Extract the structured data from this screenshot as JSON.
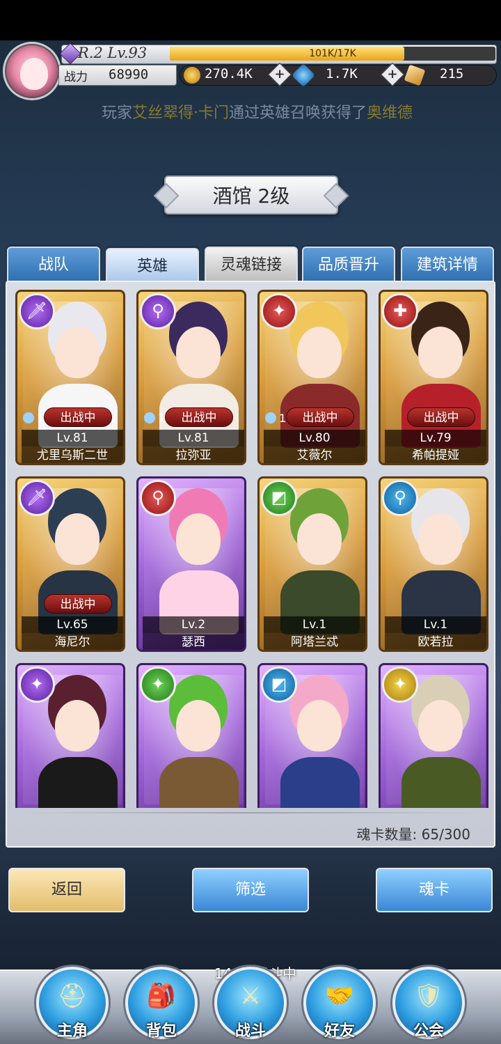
{
  "header": {
    "level_text": "R.2 Lv.93",
    "exp_text": "101K/17K",
    "exp_fraction": 0.72,
    "power_label": "战力",
    "power_value": "68990",
    "gold": "270.4K",
    "diamond": "1.7K",
    "ticket": "215",
    "ticker_prefix": "玩家",
    "ticker_player": "艾丝翠得·卡门",
    "ticker_mid": "通过英雄召唤获得了",
    "ticker_hero": "奥维德"
  },
  "title": "酒馆 2级",
  "tabs": [
    {
      "label": "战队",
      "style": "blue"
    },
    {
      "label": "英雄",
      "style": "active"
    },
    {
      "label": "灵魂链接",
      "style": "alt"
    },
    {
      "label": "品质晋升",
      "style": "blue"
    },
    {
      "label": "建筑详情",
      "style": "blue"
    }
  ],
  "cards": [
    {
      "name": "尤里乌斯二世",
      "level": "Lv.81",
      "status": "出战中",
      "soul": "1",
      "badge": "purple",
      "badge_icon": "🗡",
      "frame": "gold",
      "hair": "#e8e8ee",
      "cloth": "#f6f6f6"
    },
    {
      "name": "拉弥亚",
      "level": "Lv.81",
      "status": "出战中",
      "soul": "1",
      "badge": "purple",
      "badge_icon": "⚲",
      "frame": "gold",
      "hair": "#3b2a5e",
      "cloth": "#f3ece4"
    },
    {
      "name": "艾薇尔",
      "level": "Lv.80",
      "status": "出战中",
      "soul": "1",
      "badge": "red",
      "badge_icon": "✦",
      "frame": "gold",
      "hair": "#f1c65a",
      "cloth": "#8a2a2a"
    },
    {
      "name": "希帕提娅",
      "level": "Lv.79",
      "status": "出战中",
      "soul": "",
      "badge": "red",
      "badge_icon": "✚",
      "frame": "gold",
      "hair": "#3a2418",
      "cloth": "#b5202a"
    },
    {
      "name": "海尼尔",
      "level": "Lv.65",
      "status": "出战中",
      "soul": "",
      "badge": "purple",
      "badge_icon": "🗡",
      "frame": "gold",
      "hair": "#2c3e52",
      "cloth": "#263444"
    },
    {
      "name": "瑟西",
      "level": "Lv.2",
      "status": "",
      "soul": "",
      "badge": "red",
      "badge_icon": "⚲",
      "frame": "purple",
      "hair": "#f07bb4",
      "cloth": "#ffd3e6"
    },
    {
      "name": "阿塔兰忒",
      "level": "Lv.1",
      "status": "",
      "soul": "",
      "badge": "green",
      "badge_icon": "◩",
      "frame": "gold",
      "hair": "#6fa33a",
      "cloth": "#3a4a2a"
    },
    {
      "name": "欧若拉",
      "level": "Lv.1",
      "status": "",
      "soul": "",
      "badge": "blue",
      "badge_icon": "⚲",
      "frame": "gold",
      "hair": "#e6e6ea",
      "cloth": "#2a3444"
    },
    {
      "name": "",
      "level": "",
      "status": "",
      "soul": "",
      "badge": "purple",
      "badge_icon": "✦",
      "frame": "purple",
      "hair": "#5a2030",
      "cloth": "#1a1a1a"
    },
    {
      "name": "",
      "level": "",
      "status": "",
      "soul": "",
      "badge": "green",
      "badge_icon": "✦",
      "frame": "purple",
      "hair": "#5cbd3a",
      "cloth": "#7a5a34"
    },
    {
      "name": "",
      "level": "",
      "status": "",
      "soul": "",
      "badge": "blue",
      "badge_icon": "◩",
      "frame": "purple",
      "hair": "#f5a9c8",
      "cloth": "#2a3e8a"
    },
    {
      "name": "",
      "level": "",
      "status": "",
      "soul": "",
      "badge": "yellow",
      "badge_icon": "✦",
      "frame": "purple",
      "hair": "#d8cfb6",
      "cloth": "#4a5a24"
    }
  ],
  "soul_count_label": "魂卡数量: 65/300",
  "buttons": {
    "back": "返回",
    "filter": "筛选",
    "soulcard": "魂卡"
  },
  "battle_status": "144层战斗中",
  "nav": [
    {
      "label": "主角",
      "icon": "helmet-icon",
      "glyph": "⛑"
    },
    {
      "label": "背包",
      "icon": "backpack-icon",
      "glyph": "🎒"
    },
    {
      "label": "战斗",
      "icon": "swords-icon",
      "glyph": "⚔"
    },
    {
      "label": "好友",
      "icon": "handshake-icon",
      "glyph": "🤝"
    },
    {
      "label": "公会",
      "icon": "guild-crest-icon",
      "glyph": "🛡"
    }
  ]
}
